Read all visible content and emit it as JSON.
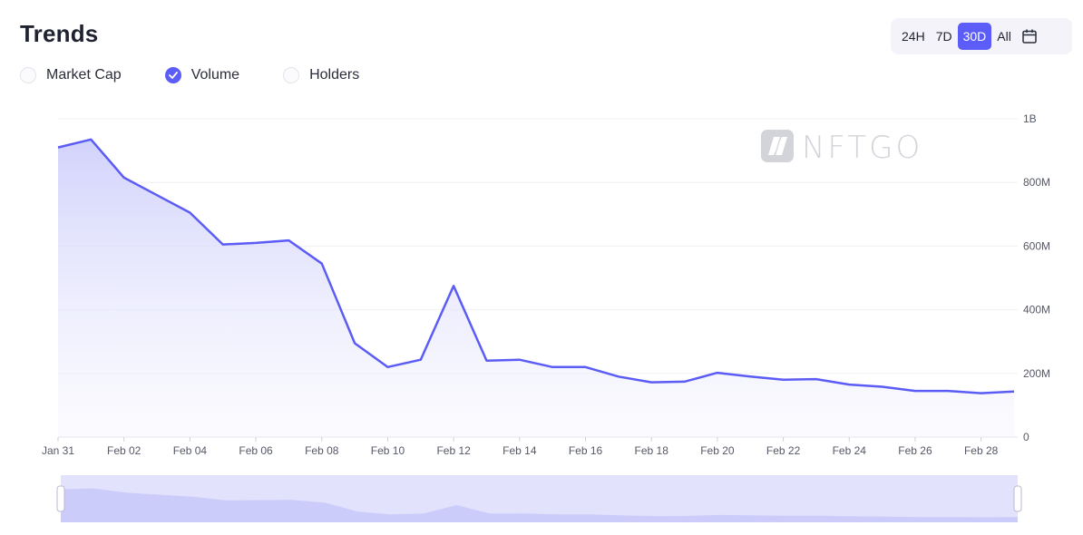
{
  "header": {
    "title": "Trends"
  },
  "range": {
    "options": [
      "24H",
      "7D",
      "30D",
      "All"
    ],
    "selected": "30D",
    "calendar_icon": "calendar-icon"
  },
  "metrics": [
    {
      "label": "Market Cap",
      "checked": false
    },
    {
      "label": "Volume",
      "checked": true
    },
    {
      "label": "Holders",
      "checked": false
    }
  ],
  "watermark": "NFTGO",
  "colors": {
    "accent": "#5c5cf8",
    "line": "#5b5cf6",
    "area": "#e4e4fd",
    "grid": "#f0f0f3"
  },
  "chart_data": {
    "type": "area",
    "x": [
      "Jan 31",
      "Feb 01",
      "Feb 02",
      "Feb 03",
      "Feb 04",
      "Feb 05",
      "Feb 06",
      "Feb 07",
      "Feb 08",
      "Feb 09",
      "Feb 10",
      "Feb 11",
      "Feb 12",
      "Feb 13",
      "Feb 14",
      "Feb 15",
      "Feb 16",
      "Feb 17",
      "Feb 18",
      "Feb 19",
      "Feb 20",
      "Feb 21",
      "Feb 22",
      "Feb 23",
      "Feb 24",
      "Feb 25",
      "Feb 26",
      "Feb 27",
      "Feb 28",
      "Mar 01"
    ],
    "x_tick_labels": [
      "Jan 31",
      "Feb 02",
      "Feb 04",
      "Feb 06",
      "Feb 08",
      "Feb 10",
      "Feb 12",
      "Feb 14",
      "Feb 16",
      "Feb 18",
      "Feb 20",
      "Feb 22",
      "Feb 24",
      "Feb 26",
      "Feb 28"
    ],
    "series": [
      {
        "values": [
          910000000,
          935000000,
          815000000,
          760000000,
          705000000,
          605000000,
          610000000,
          618000000,
          545000000,
          295000000,
          220000000,
          243000000,
          475000000,
          240000000,
          243000000,
          220000000,
          220000000,
          190000000,
          172000000,
          174000000,
          202000000,
          190000000,
          180000000,
          182000000,
          165000000,
          158000000,
          145000000,
          145000000,
          138000000,
          143000000
        ]
      }
    ],
    "y_tick_labels": [
      "0",
      "200M",
      "400M",
      "600M",
      "800M",
      "1B"
    ],
    "ylim": [
      0,
      1000000000
    ],
    "y_axis_side": "right",
    "grid": true,
    "brush": {
      "range": [
        0,
        1
      ]
    }
  }
}
